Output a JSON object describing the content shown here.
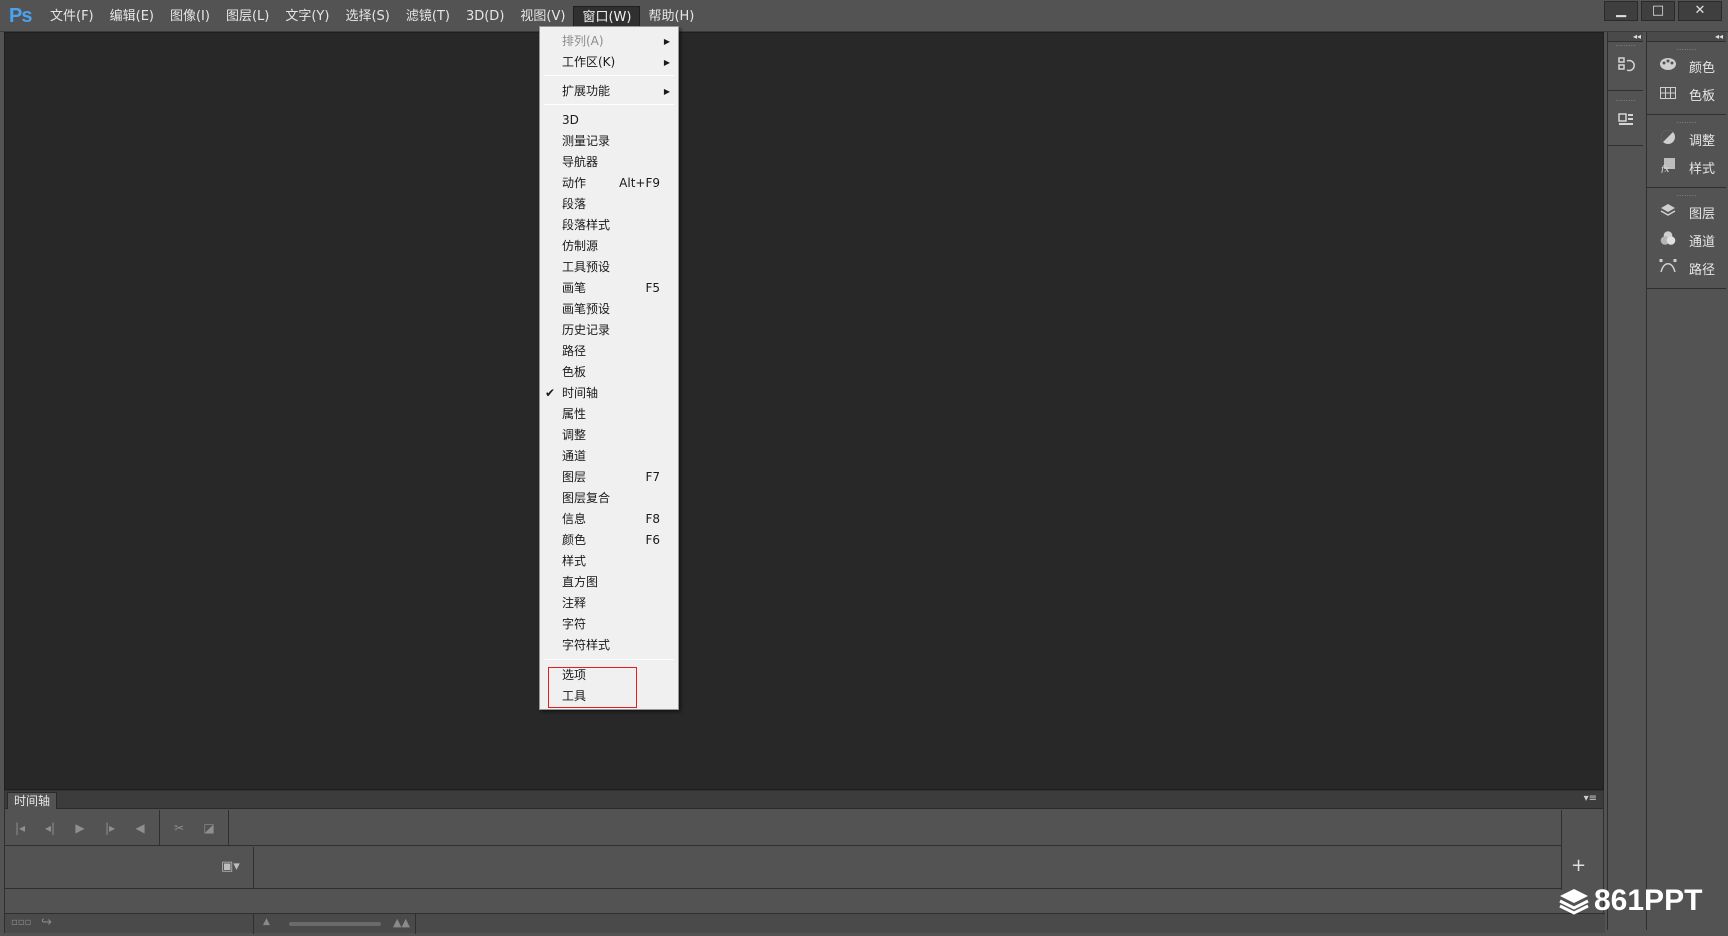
{
  "app": {
    "logo": "Ps",
    "menus": [
      "文件(F)",
      "编辑(E)",
      "图像(I)",
      "图层(L)",
      "文字(Y)",
      "选择(S)",
      "滤镜(T)",
      "3D(D)",
      "视图(V)",
      "窗口(W)",
      "帮助(H)"
    ],
    "active_menu": "窗口(W)",
    "window_controls": {
      "minimize": "▁",
      "maximize": "□",
      "close": "✕"
    }
  },
  "window_menu": {
    "items": [
      {
        "label": "排列(A)",
        "disabled": true,
        "submenu": true
      },
      {
        "label": "工作区(K)",
        "submenu": true
      },
      {
        "label": "扩展功能",
        "submenu": true
      },
      {
        "label": "3D"
      },
      {
        "label": "测量记录"
      },
      {
        "label": "导航器"
      },
      {
        "label": "动作",
        "shortcut": "Alt+F9"
      },
      {
        "label": "段落"
      },
      {
        "label": "段落样式"
      },
      {
        "label": "仿制源"
      },
      {
        "label": "工具预设"
      },
      {
        "label": "画笔",
        "shortcut": "F5"
      },
      {
        "label": "画笔预设"
      },
      {
        "label": "历史记录"
      },
      {
        "label": "路径"
      },
      {
        "label": "色板"
      },
      {
        "label": "时间轴",
        "checked": true
      },
      {
        "label": "属性"
      },
      {
        "label": "调整"
      },
      {
        "label": "通道"
      },
      {
        "label": "图层",
        "shortcut": "F7"
      },
      {
        "label": "图层复合"
      },
      {
        "label": "信息",
        "shortcut": "F8"
      },
      {
        "label": "颜色",
        "shortcut": "F6"
      },
      {
        "label": "样式"
      },
      {
        "label": "直方图"
      },
      {
        "label": "注释"
      },
      {
        "label": "字符"
      },
      {
        "label": "字符样式"
      },
      {
        "label": "选项"
      },
      {
        "label": "工具"
      }
    ],
    "check_mark": "✔",
    "submenu_arrow": "▶"
  },
  "right_strip": {
    "collapse": "◂◂",
    "buttons": [
      {
        "icon": "history-icon"
      },
      {
        "icon": "properties-icon"
      }
    ]
  },
  "right_panel": {
    "collapse": "◂◂",
    "groups": [
      [
        {
          "label": "颜色",
          "icon": "palette-icon"
        },
        {
          "label": "色板",
          "icon": "swatches-grid-icon"
        }
      ],
      [
        {
          "label": "调整",
          "icon": "adjustment-circle-icon"
        },
        {
          "label": "样式",
          "icon": "fx-style-icon"
        }
      ],
      [
        {
          "label": "图层",
          "icon": "layers-icon"
        },
        {
          "label": "通道",
          "icon": "channels-icon"
        },
        {
          "label": "路径",
          "icon": "paths-icon"
        }
      ]
    ]
  },
  "timeline": {
    "tab_label": "时间轴",
    "add_symbol": "+"
  },
  "watermark": {
    "text": "861PPT"
  }
}
